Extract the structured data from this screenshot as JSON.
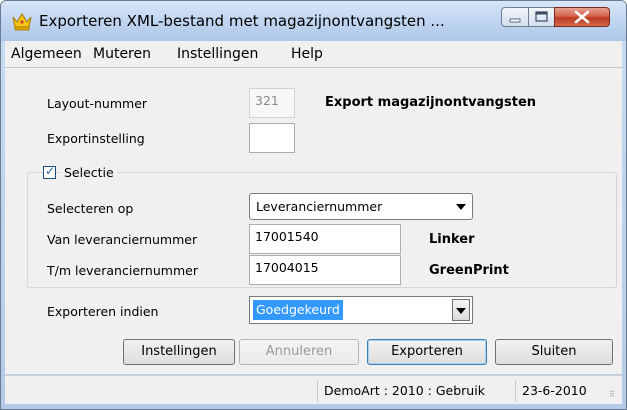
{
  "window": {
    "title": "Exporteren XML-bestand met magazijnontvangsten ...",
    "app_icon": "crown-icon"
  },
  "menu": [
    "Algemeen",
    "Muteren",
    "Instellingen",
    "Help"
  ],
  "form": {
    "layout_label": "Layout-nummer",
    "layout_value": "321",
    "layout_title": "Export magazijnontvangsten",
    "export_setting_label": "Exportinstelling",
    "export_setting_value": "",
    "selection_label": "Selectie",
    "selection_checked": true,
    "select_on_label": "Selecteren op",
    "select_on_value": "Leveranciernummer",
    "from_label": "Van leveranciernummer",
    "from_value": "17001540",
    "from_name": "Linker",
    "to_label": "T/m leveranciernummer",
    "to_value": "17004015",
    "to_name": "GreenPrint",
    "export_if_label": "Exporteren indien",
    "export_if_value": "Goedgekeurd"
  },
  "buttons": {
    "settings": "Instellingen",
    "cancel": "Annuleren",
    "export": "Exporteren",
    "close": "Sluiten"
  },
  "status": {
    "context": "DemoArt : 2010 : Gebruik",
    "date": "23-6-2010"
  }
}
